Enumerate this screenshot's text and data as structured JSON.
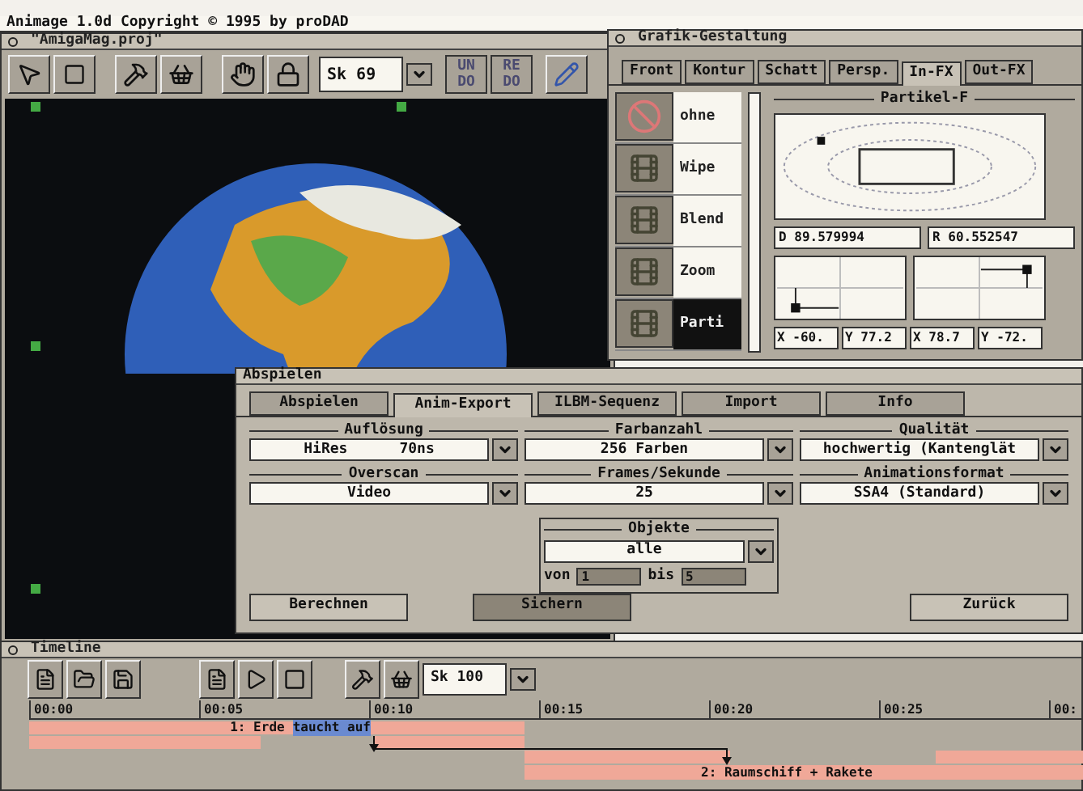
{
  "screen_title": "Animage 1.0d Copyright © 1995 by proDAD",
  "project_window": {
    "title": "\"AmigaMag.proj\"",
    "scene_field": "Sk 69",
    "undo": "UN DO",
    "redo": "RE DO"
  },
  "grafik_window": {
    "title": "Grafik-Gestaltung",
    "tabs": [
      {
        "label": "Front",
        "selected": false
      },
      {
        "label": "Kontur",
        "selected": false
      },
      {
        "label": "Schatt",
        "selected": false
      },
      {
        "label": "Persp.",
        "selected": false
      },
      {
        "label": "In-FX",
        "selected": true
      },
      {
        "label": "Out-FX",
        "selected": false
      }
    ],
    "effects": [
      {
        "label": "ohne",
        "selected": false
      },
      {
        "label": "Wipe",
        "selected": false
      },
      {
        "label": "Blend",
        "selected": false
      },
      {
        "label": "Zoom",
        "selected": false
      },
      {
        "label": "Parti",
        "selected": true
      }
    ],
    "particle_panel": {
      "title": "Partikel-F",
      "d_field": "D 89.579994",
      "r_field": "R 60.552547",
      "coords": [
        "X -60.",
        "Y 77.2",
        "X 78.7",
        "Y -72."
      ]
    }
  },
  "export_dialog": {
    "title": "Abspielen",
    "tabs": [
      {
        "label": "Abspielen",
        "selected": false
      },
      {
        "label": "Anim-Export",
        "selected": true
      },
      {
        "label": "ILBM-Sequenz",
        "selected": false
      },
      {
        "label": "Import",
        "selected": false
      },
      {
        "label": "Info",
        "selected": false
      }
    ],
    "fields": [
      {
        "label": "Auflösung",
        "value": "HiRes",
        "value_2": "70ns"
      },
      {
        "label": "Farbanzahl",
        "value": "256 Farben"
      },
      {
        "label": "Qualität",
        "value": "hochwertig (Kantenglät"
      },
      {
        "label": "Overscan",
        "value": "Video"
      },
      {
        "label": "Frames/Sekunde",
        "value": "25"
      },
      {
        "label": "Animationsformat",
        "value": "SSA4 (Standard)"
      }
    ],
    "objects": {
      "label": "Objekte",
      "value": "alle",
      "from_label": "von",
      "from_value": "1",
      "to_label": "bis",
      "to_value": "5"
    },
    "buttons": [
      {
        "label": "Berechnen",
        "selected": false
      },
      {
        "label": "Sichern",
        "selected": true
      },
      {
        "label": "Zurück",
        "selected": false
      }
    ]
  },
  "timeline": {
    "title": "Timeline",
    "scene_field": "Sk 100",
    "ticks": [
      "00:00",
      "00:05",
      "00:10",
      "00:15",
      "00:20",
      "00:25",
      "00:"
    ],
    "tracks": [
      {
        "parts": [
          {
            "text": "1: Erde",
            "selected": false
          },
          {
            "text": "taucht auf",
            "selected": true
          }
        ]
      },
      {
        "parts": [
          {
            "text": "2: Raumschiff + Rakete",
            "selected": false
          }
        ]
      }
    ]
  }
}
